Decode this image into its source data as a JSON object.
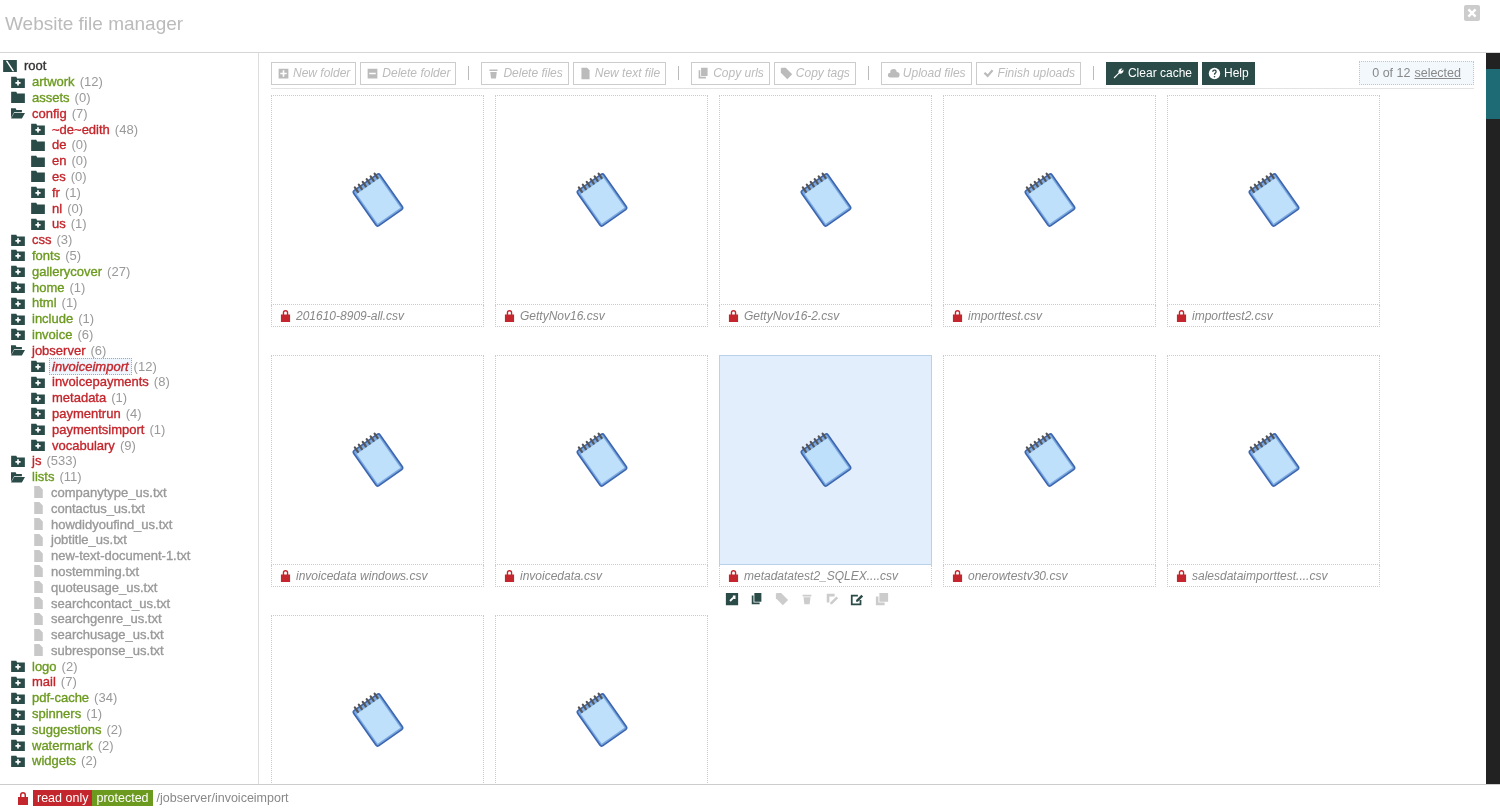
{
  "window": {
    "title": "Website file manager"
  },
  "tree": [
    {
      "kind": "root",
      "name": "root",
      "selected": false,
      "children": [
        {
          "kind": "collapsed",
          "name": "artwork",
          "count": "(12)",
          "color": "#6b9a1f",
          "selected": false
        },
        {
          "kind": "empty",
          "name": "assets",
          "count": "(0)",
          "color": "#6b9a1f",
          "selected": false
        },
        {
          "kind": "open",
          "name": "config",
          "count": "(7)",
          "color": "#c3262c",
          "selected": false,
          "children": [
            {
              "kind": "collapsed",
              "name": "~de~edith",
              "count": "(48)",
              "color": "#c3262c",
              "selected": false
            },
            {
              "kind": "empty",
              "name": "de",
              "count": "(0)",
              "color": "#c3262c",
              "selected": false
            },
            {
              "kind": "empty",
              "name": "en",
              "count": "(0)",
              "color": "#c3262c",
              "selected": false
            },
            {
              "kind": "empty",
              "name": "es",
              "count": "(0)",
              "color": "#c3262c",
              "selected": false
            },
            {
              "kind": "collapsed",
              "name": "fr",
              "count": "(1)",
              "color": "#c3262c",
              "selected": false
            },
            {
              "kind": "empty",
              "name": "nl",
              "count": "(0)",
              "color": "#c3262c",
              "selected": false
            },
            {
              "kind": "collapsed",
              "name": "us",
              "count": "(1)",
              "color": "#c3262c",
              "selected": false
            }
          ]
        },
        {
          "kind": "collapsed",
          "name": "css",
          "count": "(3)",
          "color": "#c3262c",
          "selected": false
        },
        {
          "kind": "collapsed",
          "name": "fonts",
          "count": "(5)",
          "color": "#6b9a1f",
          "selected": false
        },
        {
          "kind": "collapsed",
          "name": "gallerycover",
          "count": "(27)",
          "color": "#6b9a1f",
          "selected": false
        },
        {
          "kind": "collapsed",
          "name": "home",
          "count": "(1)",
          "color": "#6b9a1f",
          "selected": false
        },
        {
          "kind": "collapsed",
          "name": "html",
          "count": "(1)",
          "color": "#6b9a1f",
          "selected": false
        },
        {
          "kind": "collapsed",
          "name": "include",
          "count": "(1)",
          "color": "#6b9a1f",
          "selected": false
        },
        {
          "kind": "collapsed",
          "name": "invoice",
          "count": "(6)",
          "color": "#6b9a1f",
          "selected": false
        },
        {
          "kind": "open",
          "name": "jobserver",
          "count": "(6)",
          "color": "#c3262c",
          "selected": false,
          "children": [
            {
              "kind": "collapsed",
              "name": "invoiceimport",
              "count": "(12)",
              "color": "#c3262c",
              "selected": true
            },
            {
              "kind": "collapsed",
              "name": "invoicepayments",
              "count": "(8)",
              "color": "#c3262c",
              "selected": false
            },
            {
              "kind": "collapsed",
              "name": "metadata",
              "count": "(1)",
              "color": "#c3262c",
              "selected": false
            },
            {
              "kind": "collapsed",
              "name": "paymentrun",
              "count": "(4)",
              "color": "#c3262c",
              "selected": false
            },
            {
              "kind": "collapsed",
              "name": "paymentsimport",
              "count": "(1)",
              "color": "#c3262c",
              "selected": false
            },
            {
              "kind": "collapsed",
              "name": "vocabulary",
              "count": "(9)",
              "color": "#c3262c",
              "selected": false
            }
          ]
        },
        {
          "kind": "collapsed",
          "name": "js",
          "count": "(533)",
          "color": "#c3262c",
          "selected": false
        },
        {
          "kind": "open",
          "name": "lists",
          "count": "(11)",
          "color": "#6b9a1f",
          "selected": false,
          "children": [
            {
              "kind": "file",
              "name": "companytype_us.txt",
              "selected": false
            },
            {
              "kind": "file",
              "name": "contactus_us.txt",
              "selected": false
            },
            {
              "kind": "file",
              "name": "howdidyoufind_us.txt",
              "selected": false
            },
            {
              "kind": "file",
              "name": "jobtitle_us.txt",
              "selected": false
            },
            {
              "kind": "file",
              "name": "new-text-document-1.txt",
              "selected": false
            },
            {
              "kind": "file",
              "name": "nostemming.txt",
              "selected": false
            },
            {
              "kind": "file",
              "name": "quoteusage_us.txt",
              "selected": false
            },
            {
              "kind": "file",
              "name": "searchcontact_us.txt",
              "selected": false
            },
            {
              "kind": "file",
              "name": "searchgenre_us.txt",
              "selected": false
            },
            {
              "kind": "file",
              "name": "searchusage_us.txt",
              "selected": false
            },
            {
              "kind": "file",
              "name": "subresponse_us.txt",
              "selected": false
            }
          ]
        },
        {
          "kind": "collapsed",
          "name": "logo",
          "count": "(2)",
          "color": "#6b9a1f",
          "selected": false
        },
        {
          "kind": "collapsed",
          "name": "mail",
          "count": "(7)",
          "color": "#c3262c",
          "selected": false
        },
        {
          "kind": "collapsed",
          "name": "pdf-cache",
          "count": "(34)",
          "color": "#6b9a1f",
          "selected": false
        },
        {
          "kind": "collapsed",
          "name": "spinners",
          "count": "(1)",
          "color": "#6b9a1f",
          "selected": false
        },
        {
          "kind": "collapsed",
          "name": "suggestions",
          "count": "(2)",
          "color": "#6b9a1f",
          "selected": false
        },
        {
          "kind": "collapsed",
          "name": "watermark",
          "count": "(2)",
          "color": "#6b9a1f",
          "selected": false
        },
        {
          "kind": "collapsed",
          "name": "widgets",
          "count": "(2)",
          "color": "#6b9a1f",
          "selected": false
        }
      ]
    }
  ],
  "toolbar": [
    [
      {
        "kind": "plus",
        "label": "New folder",
        "disabled": true
      },
      {
        "kind": "minus",
        "label": "Delete folder",
        "disabled": true
      }
    ],
    [
      {
        "kind": "trash",
        "label": "Delete files",
        "disabled": true
      },
      {
        "kind": "document",
        "label": "New text file",
        "disabled": true
      }
    ],
    [
      {
        "kind": "copy",
        "label": "Copy urls",
        "disabled": true
      },
      {
        "kind": "tag",
        "label": "Copy tags",
        "disabled": true
      }
    ],
    [
      {
        "kind": "upload",
        "label": "Upload files",
        "disabled": true
      },
      {
        "kind": "check",
        "label": "Finish uploads",
        "disabled": true
      }
    ],
    [
      {
        "kind": "wrench",
        "label": "Clear cache",
        "disabled": false
      },
      {
        "kind": "help",
        "label": "Help",
        "disabled": false
      }
    ]
  ],
  "selection": {
    "count": "0 of 12",
    "link": "selected"
  },
  "files": [
    {
      "name": "201610-8909-all.csv",
      "locked": true,
      "selected": false,
      "hovered": false
    },
    {
      "name": "GettyNov16.csv",
      "locked": true,
      "selected": false,
      "hovered": false
    },
    {
      "name": "GettyNov16-2.csv",
      "locked": true,
      "selected": false,
      "hovered": false
    },
    {
      "name": "importtest.csv",
      "locked": true,
      "selected": false,
      "hovered": false
    },
    {
      "name": "importtest2.csv",
      "locked": true,
      "selected": false,
      "hovered": false
    },
    {
      "name": "invoicedata windows.csv",
      "locked": true,
      "selected": false,
      "hovered": false
    },
    {
      "name": "invoicedata.csv",
      "locked": true,
      "selected": false,
      "hovered": false
    },
    {
      "name": "metadatatest2_SQLEX....csv",
      "locked": true,
      "selected": false,
      "hovered": true
    },
    {
      "name": "onerowtestv30.csv",
      "locked": true,
      "selected": false,
      "hovered": false
    },
    {
      "name": "salesdataimporttest....csv",
      "locked": true,
      "selected": false,
      "hovered": false
    },
    {
      "selected": false,
      "hovered": false
    },
    {
      "selected": false,
      "hovered": false
    }
  ],
  "file_actions": [
    {
      "kind": "open",
      "disabled": false
    },
    {
      "kind": "copy",
      "disabled": false
    },
    {
      "kind": "tag",
      "disabled": true
    },
    {
      "kind": "trash",
      "disabled": true
    },
    {
      "kind": "rename",
      "disabled": true
    },
    {
      "kind": "edit",
      "disabled": false
    },
    {
      "kind": "duplicate",
      "disabled": true
    }
  ],
  "status_bar": {
    "badges": [
      {
        "label": "read only",
        "color": "#c3262c"
      },
      {
        "label": "protected",
        "color": "#6b9a1f"
      }
    ],
    "path": "/jobserver/invoiceimport"
  }
}
